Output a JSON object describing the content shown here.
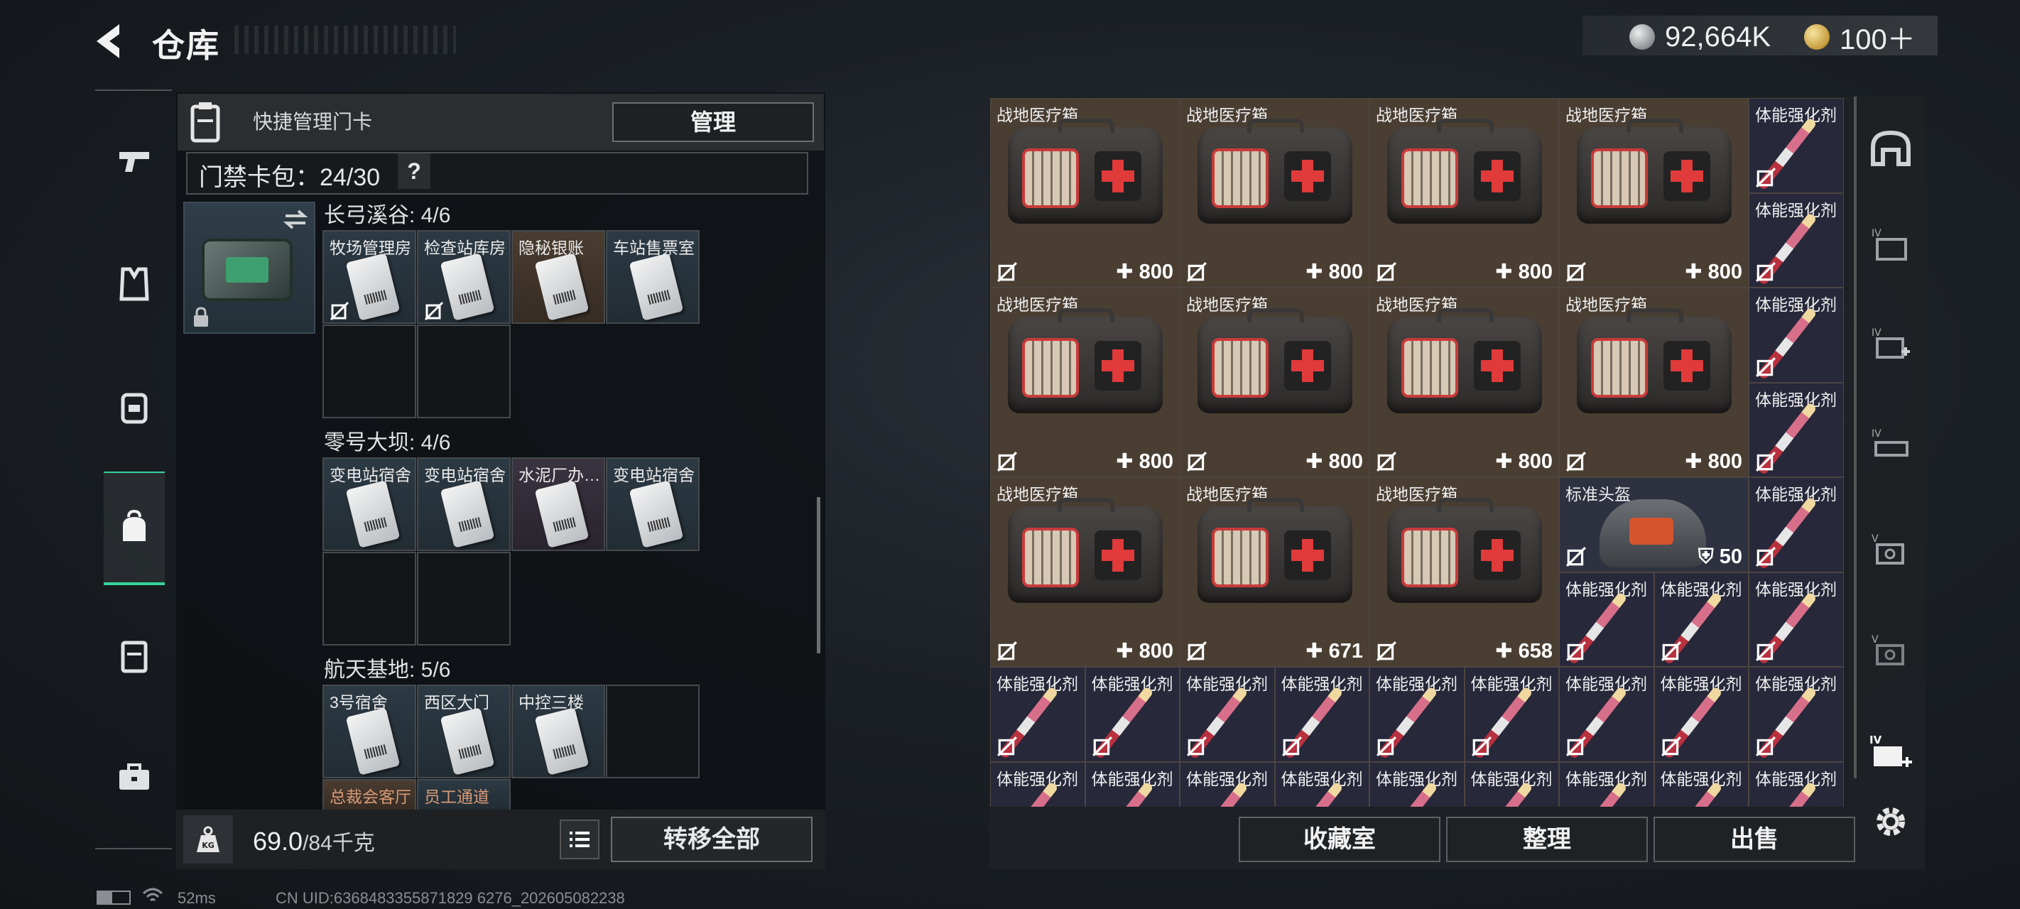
{
  "header": {
    "title": "仓库",
    "currency_silver": "92,664K",
    "currency_gold": "100＋"
  },
  "quick_manage": {
    "label": "快捷管理门卡",
    "manage_button": "管理",
    "card_count": "门禁卡包：24/30",
    "help": "?"
  },
  "sections": [
    {
      "title": "长弓溪谷: 4/6",
      "cards": [
        "牧场管理房",
        "检查站库房",
        "隐秘银账",
        "车站售票室"
      ]
    },
    {
      "title": "零号大坝: 4/6",
      "cards": [
        "变电站宿舍",
        "变电站宿舍",
        "水泥厂办…",
        "变电站宿舍"
      ]
    },
    {
      "title": "航天基地: 5/6",
      "cards": [
        "3号宿舍",
        "西区大门",
        "中控三楼"
      ],
      "partial": [
        "总裁会客厅",
        "员工通道"
      ]
    }
  ],
  "bottom_left": {
    "weight_value": "69.0",
    "weight_limit": "/84千克",
    "transfer_all": "转移全部"
  },
  "inventory": {
    "medkit_name": "战地医疗箱",
    "injector_name": "体能强化剂",
    "helmet_name": "标准头盔",
    "medkit_values": [
      "800",
      "800",
      "800",
      "800",
      "800",
      "800",
      "800",
      "800",
      "800",
      "671",
      "658"
    ],
    "helmet_value": "50"
  },
  "bottom_right": {
    "collection": "收藏室",
    "sort": "整理",
    "sell": "出售"
  },
  "footer": {
    "ping": "52ms",
    "uid": "CN UID:6368483355871829 6276_202605082238"
  }
}
